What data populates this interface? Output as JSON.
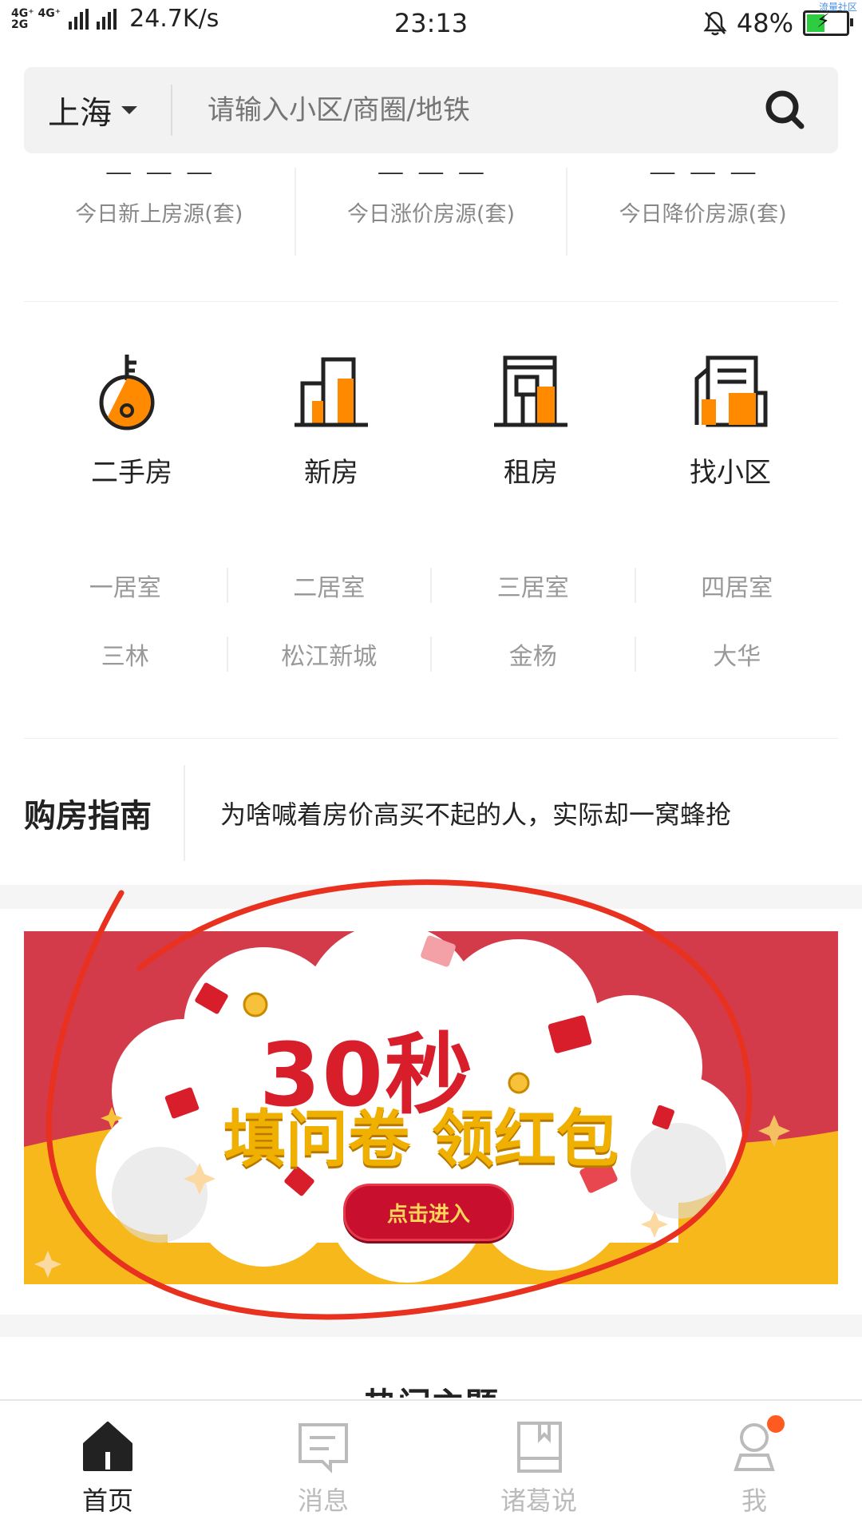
{
  "status_bar": {
    "network_top": "4G⁺ 4G⁺",
    "network_bottom": "2G",
    "speed": "24.7K/s",
    "time": "23:13",
    "battery_percent": "48%",
    "battery_level": 0.48,
    "watermark": "流量社区"
  },
  "search": {
    "city": "上海",
    "placeholder": "请输入小区/商圈/地铁"
  },
  "stats": [
    {
      "label": "今日新上房源(套)"
    },
    {
      "label": "今日涨价房源(套)"
    },
    {
      "label": "今日降价房源(套)"
    }
  ],
  "categories": [
    {
      "label": "二手房",
      "icon": "key-icon"
    },
    {
      "label": "新房",
      "icon": "new-building-icon"
    },
    {
      "label": "租房",
      "icon": "rental-building-icon"
    },
    {
      "label": "找小区",
      "icon": "community-icon"
    }
  ],
  "tags": [
    [
      "一居室",
      "二居室",
      "三居室",
      "四居室"
    ],
    [
      "三林",
      "松江新城",
      "金杨",
      "大华"
    ]
  ],
  "guide": {
    "title": "购房指南",
    "text": "为啥喊着房价高买不起的人，实际却一窝蜂抢"
  },
  "banner": {
    "title": "30秒",
    "subtitle": "填问卷 领红包",
    "button": "点击进入",
    "colors": {
      "red": "#d43b4a",
      "yellow": "#f7b81c"
    }
  },
  "hot_section_title": "热门主题",
  "bottom_nav": [
    {
      "label": "首页",
      "icon": "home-icon",
      "active": true
    },
    {
      "label": "消息",
      "icon": "message-icon",
      "active": false
    },
    {
      "label": "诸葛说",
      "icon": "book-icon",
      "active": false
    },
    {
      "label": "我",
      "icon": "profile-icon",
      "active": false
    }
  ],
  "accent_color": "#ff8a00"
}
